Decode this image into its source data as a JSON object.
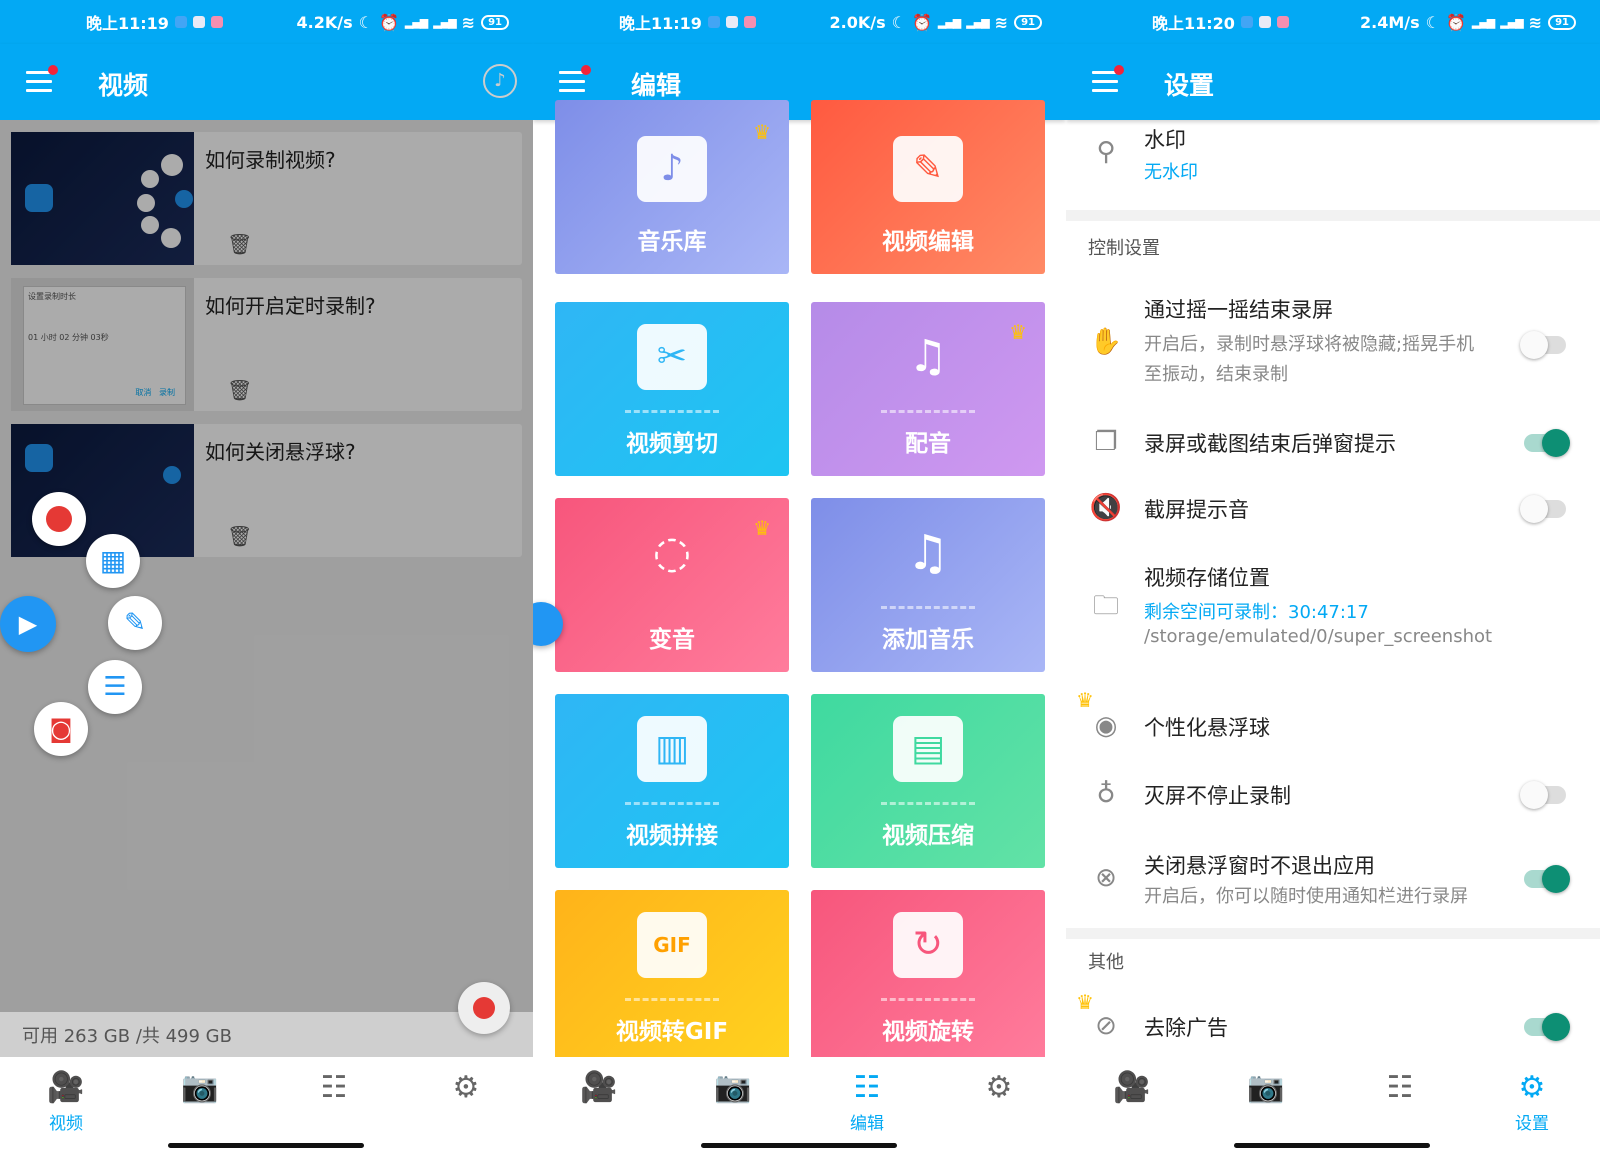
{
  "panels": {
    "video": {
      "status": {
        "time": "晚上11:19",
        "speed": "4.2K/s",
        "battery": "91"
      },
      "title": "视频",
      "items": [
        {
          "title": "如何录制视频?"
        },
        {
          "title": "如何开启定时录制?"
        },
        {
          "title": "如何关闭悬浮球?"
        }
      ],
      "thumb2": {
        "heading": "设置录制时长",
        "row": "01  小时    02  分钟    03秒",
        "cancel": "取消",
        "record": "录制"
      },
      "storage": "可用 263 GB /共 499 GB",
      "tabs": {
        "active": "视频"
      }
    },
    "edit": {
      "status": {
        "time": "晚上11:19",
        "speed": "2.0K/s",
        "battery": "91"
      },
      "title": "编辑",
      "tiles": [
        "音乐库",
        "视频编辑",
        "视频剪切",
        "配音",
        "变音",
        "添加音乐",
        "视频拼接",
        "视频压缩",
        "视频转GIF",
        "视频旋转"
      ],
      "tabs": {
        "active": "编辑"
      }
    },
    "settings": {
      "status": {
        "time": "晚上11:20",
        "speed": "2.4M/s",
        "battery": "91"
      },
      "title": "设置",
      "watermark": {
        "title": "水印",
        "value": "无水印"
      },
      "section_control": "控制设置",
      "shake": {
        "title": "通过摇一摇结束录屏",
        "desc1": "开启后，录制时悬浮球将被隐藏;摇晃手机",
        "desc2": "至振动，结束录制",
        "on": false
      },
      "popup": {
        "title": "录屏或截图结束后弹窗提示",
        "on": true
      },
      "sound": {
        "title": "截屏提示音",
        "on": false
      },
      "location": {
        "title": "视频存储位置",
        "remain": "剩余空间可录制：30:47:17",
        "path": "/storage/emulated/0/super_screenshot"
      },
      "ball": {
        "title": "个性化悬浮球"
      },
      "screen_off": {
        "title": "灭屏不停止录制",
        "on": false
      },
      "no_exit": {
        "title": "关闭悬浮窗时不退出应用",
        "desc": "开启后，你可以随时使用通知栏进行录屏",
        "on": true
      },
      "section_other": "其他",
      "remove_ads": {
        "title": "去除广告",
        "on": true
      },
      "tabs": {
        "active": "设置"
      }
    }
  },
  "colors": {
    "primary": "#03a9f4",
    "primary_dim": "#0277b4",
    "toggle_on": "#0d8f74",
    "crown": "#ffc107"
  },
  "icons": [
    "hamburger-icon",
    "music-note-icon",
    "trash-icon",
    "video-camera-icon",
    "camera-icon",
    "sliders-icon",
    "gear-icon",
    "crown-icon",
    "stamp-icon",
    "shake-icon",
    "window-icon",
    "speaker-mute-icon",
    "folder-icon",
    "record-ball-icon",
    "bulb-icon",
    "close-circle-icon",
    "no-ads-icon"
  ]
}
